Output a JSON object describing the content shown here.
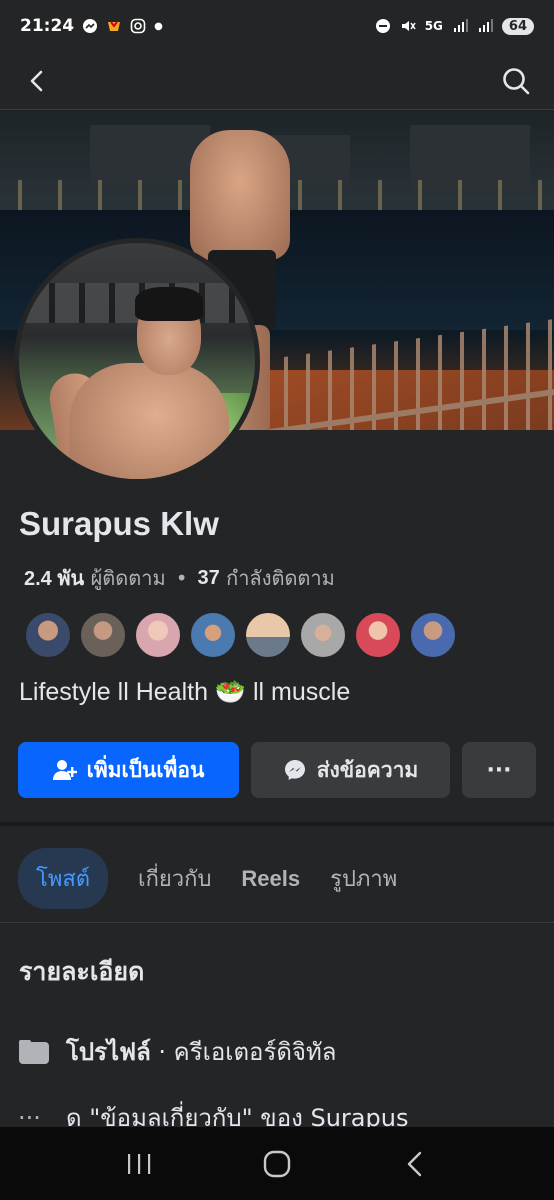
{
  "status_bar": {
    "time": "21:24",
    "network": "5G",
    "battery": "64"
  },
  "profile": {
    "name": "Surapus Klw",
    "followers_count": "2.4 พัน",
    "followers_label": "ผู้ติดตาม",
    "following_count": "37",
    "following_label": "กำลังติดตาม",
    "bio": "Lifestyle ll Health 🥗 ll muscle"
  },
  "friends": [
    {
      "name": "friend-1",
      "color": "#3a4a6a"
    },
    {
      "name": "friend-2",
      "color": "#6a6258"
    },
    {
      "name": "friend-3",
      "color": "#d9a6b0"
    },
    {
      "name": "friend-4",
      "color": "#4a7ab0"
    },
    {
      "name": "friend-5",
      "color": "#d8b08a"
    },
    {
      "name": "friend-6",
      "color": "#a8a8a8"
    },
    {
      "name": "friend-7",
      "color": "#d84a5a"
    },
    {
      "name": "friend-8",
      "color": "#4a6ab0"
    }
  ],
  "actions": {
    "add_friend": "เพิ่มเป็นเพื่อน",
    "message": "ส่งข้อความ",
    "more": "···"
  },
  "tabs": [
    {
      "label": "โพสต์",
      "active": true
    },
    {
      "label": "เกี่ยวกับ",
      "active": false
    },
    {
      "label": "Reels",
      "active": false
    },
    {
      "label": "รูปภาพ",
      "active": false
    }
  ],
  "details": {
    "title": "รายละเอียด",
    "profile_type_bold": "โปรไฟล์",
    "profile_type_rest": " · ครีเอเตอร์ดิจิทัล",
    "about_link": "ดู \"ข้อมูลเกี่ยวกับ\" ของ Surapus"
  }
}
